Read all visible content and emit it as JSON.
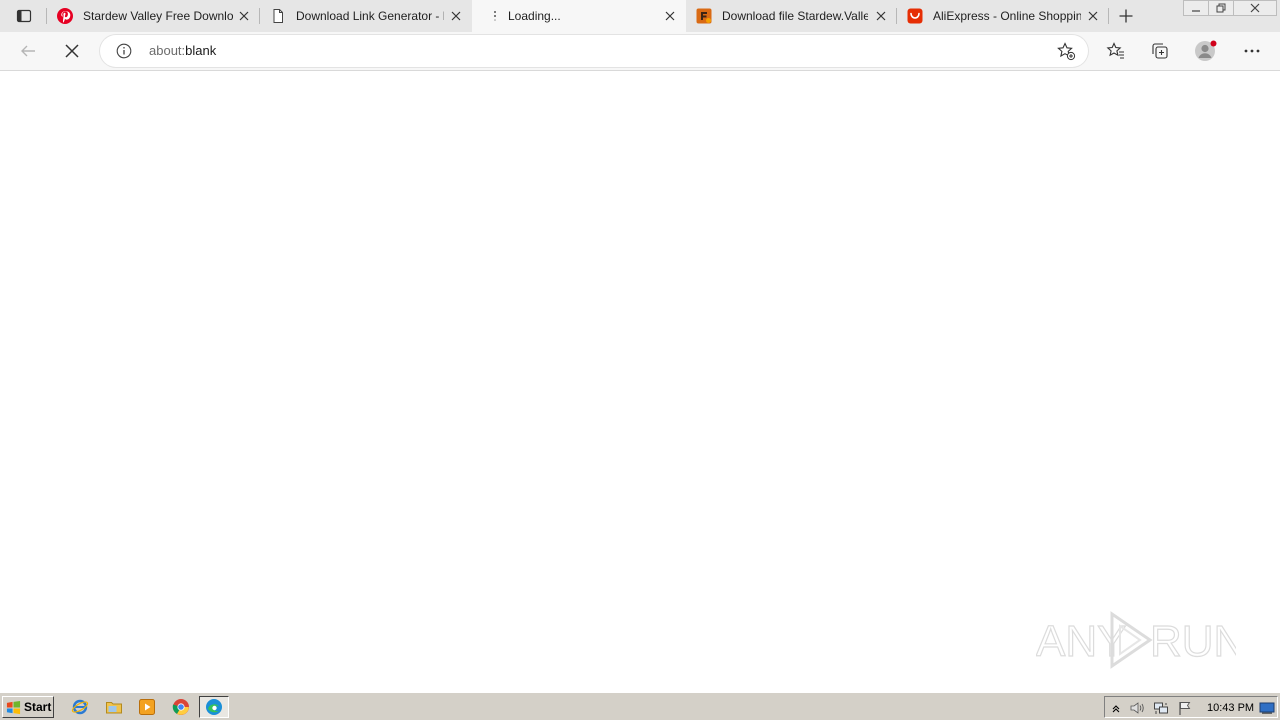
{
  "browser": {
    "tabs": [
      {
        "title": "Stardew Valley Free Download",
        "favicon": "pinterest-icon",
        "active": false
      },
      {
        "title": "Download Link Generator - M",
        "favicon": "page-icon",
        "active": false
      },
      {
        "title": "Loading...",
        "favicon": "loading-icon",
        "active": true
      },
      {
        "title": "Download file Stardew.Valle",
        "favicon": "file-site-icon",
        "active": false
      },
      {
        "title": "AliExpress - Online Shopping",
        "favicon": "aliexpress-icon",
        "active": false
      }
    ],
    "address": {
      "prefix": "about:",
      "host": "blank"
    }
  },
  "watermark": {
    "text_left": "ANY",
    "text_right": "RUN"
  },
  "taskbar": {
    "start_label": "Start",
    "clock": "10:43 PM"
  },
  "colors": {
    "tabstrip": "#e6e6e6",
    "toolbar": "#f7f7f7",
    "taskbar": "#d4d0c8",
    "pinterest": "#e60023",
    "aliexpress": "#e62e04"
  }
}
